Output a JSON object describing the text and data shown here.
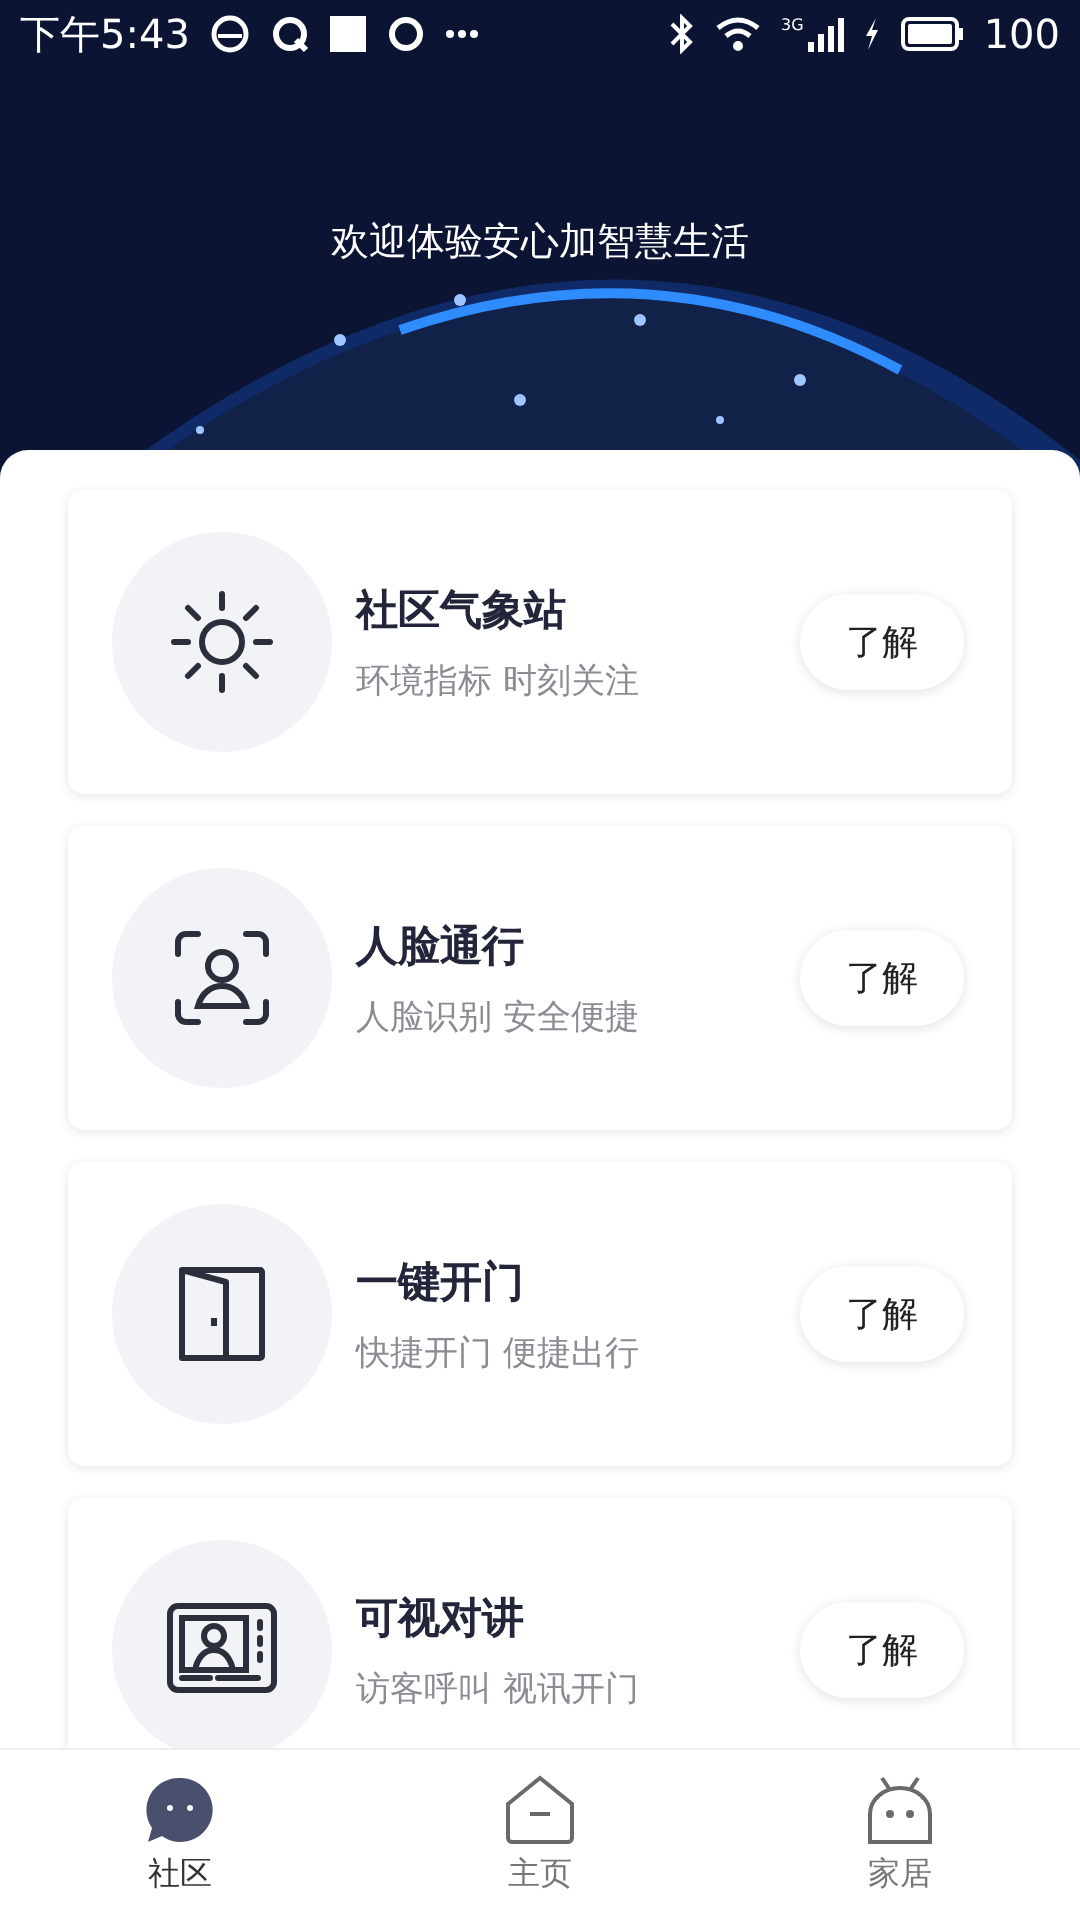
{
  "status_bar": {
    "time": "下午5:43",
    "network": "3G",
    "battery": "100"
  },
  "header": {
    "title": "欢迎体验安心加智慧生活"
  },
  "services": [
    {
      "kind": "sun",
      "title": "社区气象站",
      "subtitle": "环境指标 时刻关注",
      "button": "了解"
    },
    {
      "kind": "face",
      "title": "人脸通行",
      "subtitle": "人脸识别 安全便捷",
      "button": "了解"
    },
    {
      "kind": "door",
      "title": "一键开门",
      "subtitle": "快捷开门 便捷出行",
      "button": "了解"
    },
    {
      "kind": "intercom",
      "title": "可视对讲",
      "subtitle": "访客呼叫 视讯开门",
      "button": "了解"
    }
  ],
  "tabs": [
    {
      "kind": "chat",
      "label": "社区",
      "selected": true
    },
    {
      "kind": "home",
      "label": "主页",
      "selected": false
    },
    {
      "kind": "robot",
      "label": "家居",
      "selected": false
    }
  ]
}
